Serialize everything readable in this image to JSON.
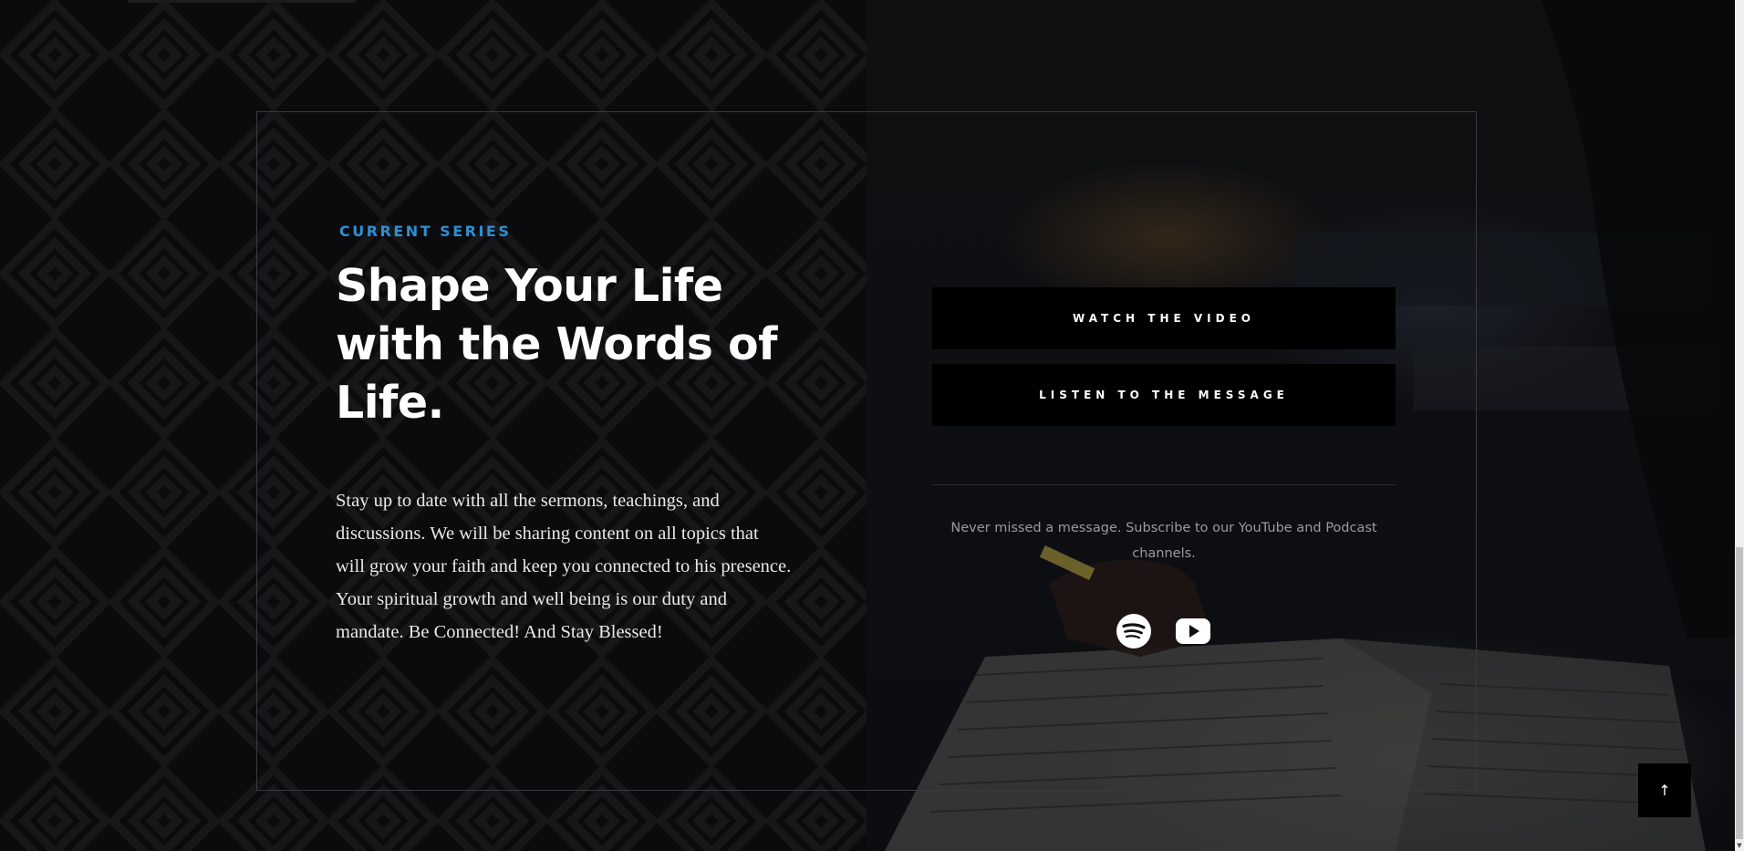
{
  "section": {
    "eyebrow": "CURRENT SERIES",
    "title": "Shape Your Life with the Words of Life.",
    "body": "Stay up to date with all the sermons, teachings, and discussions. We will be sharing content on all topics that will grow your faith and keep you connected to his presence. Your spiritual growth and well being is our duty and mandate. Be Connected! And Stay Blessed!"
  },
  "buttons": {
    "watch_label": "WATCH THE VIDEO",
    "listen_label": "LISTEN TO THE MESSAGE"
  },
  "subscribe": {
    "text": "Never missed a message. Subscribe to our YouTube and Podcast channels."
  },
  "social": [
    {
      "icon": "spotify-icon"
    },
    {
      "icon": "youtube-icon"
    }
  ],
  "scroll_top": {
    "icon": "arrow-up-icon",
    "glyph": "↑"
  },
  "colors": {
    "accent": "#2d8fd5",
    "background": "#0b0b0d",
    "button_bg": "#000000",
    "text": "#ffffff"
  }
}
